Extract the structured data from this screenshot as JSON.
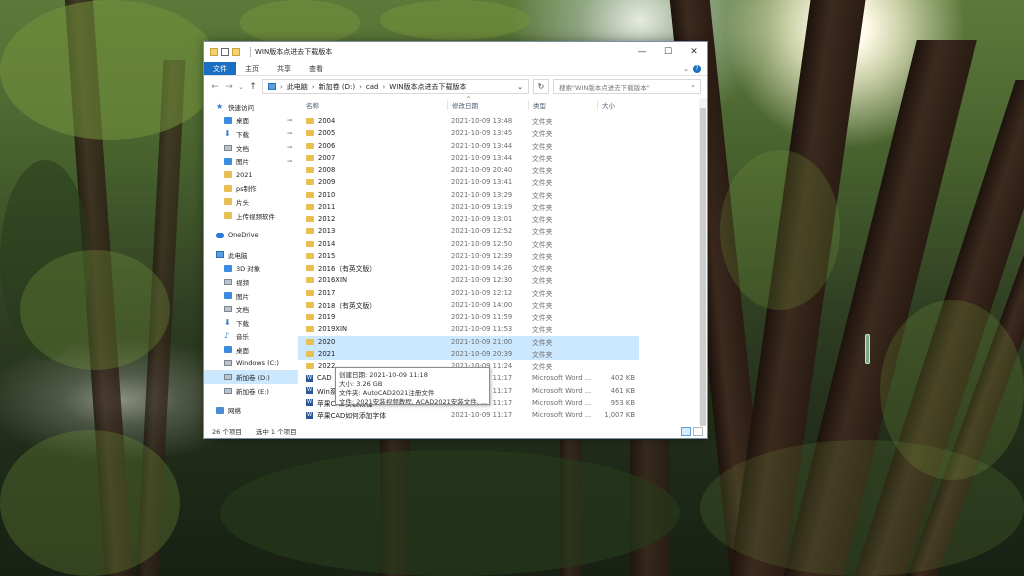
{
  "window": {
    "title": "WIN版本点进去下载版本",
    "controls": [
      "—",
      "☐",
      "✕"
    ]
  },
  "ribbon": {
    "tabs": [
      "文件",
      "主页",
      "共享",
      "查看"
    ],
    "expand": "⌄",
    "help": "?"
  },
  "address": {
    "back": "←",
    "forward": "→",
    "recent": "⌄",
    "up": "↑",
    "crumbs": [
      "此电脑",
      "新加卷 (D:)",
      "cad",
      "WIN版本点进去下载版本"
    ],
    "dropdown": "⌄",
    "refresh": "↻"
  },
  "search": {
    "placeholder": "搜索\"WIN版本点进去下载版本\"",
    "icon": "⌕"
  },
  "sidebar": {
    "items": [
      {
        "label": "快速访问",
        "icon": "star-icon"
      },
      {
        "label": "桌面",
        "icon": "desktop-icon",
        "pinned": true
      },
      {
        "label": "下载",
        "icon": "download-icon",
        "pinned": true
      },
      {
        "label": "文档",
        "icon": "documents-icon",
        "pinned": true
      },
      {
        "label": "图片",
        "icon": "pictures-icon",
        "pinned": true
      },
      {
        "label": "2021",
        "icon": "folder-icon"
      },
      {
        "label": "ps制作",
        "icon": "folder-icon"
      },
      {
        "label": "片头",
        "icon": "folder-icon"
      },
      {
        "label": "上传视频软件",
        "icon": "folder-icon"
      },
      {
        "label": "OneDrive",
        "icon": "cloud-icon"
      },
      {
        "label": "此电脑",
        "icon": "computer-icon"
      },
      {
        "label": "3D 对象",
        "icon": "3d-objects-icon"
      },
      {
        "label": "视频",
        "icon": "video-icon"
      },
      {
        "label": "图片",
        "icon": "pictures-icon"
      },
      {
        "label": "文档",
        "icon": "documents-icon"
      },
      {
        "label": "下载",
        "icon": "download-icon"
      },
      {
        "label": "音乐",
        "icon": "music-icon"
      },
      {
        "label": "桌面",
        "icon": "desktop-icon"
      },
      {
        "label": "Windows (C:)",
        "icon": "drive-icon"
      },
      {
        "label": "新加卷 (D:)",
        "icon": "drive-icon",
        "selected": true
      },
      {
        "label": "新加卷 (E:)",
        "icon": "drive-icon"
      },
      {
        "label": "网络",
        "icon": "network-icon"
      }
    ],
    "pin_glyph": "📌"
  },
  "columns": {
    "name": "名称",
    "date": "修改日期",
    "type": "类型",
    "size": "大小",
    "sort": "^"
  },
  "files": [
    {
      "name": "2004",
      "date": "2021-10-09 13:48",
      "type": "文件夹",
      "size": "",
      "kind": "folder"
    },
    {
      "name": "2005",
      "date": "2021-10-09 13:45",
      "type": "文件夹",
      "size": "",
      "kind": "folder"
    },
    {
      "name": "2006",
      "date": "2021-10-09 13:44",
      "type": "文件夹",
      "size": "",
      "kind": "folder"
    },
    {
      "name": "2007",
      "date": "2021-10-09 13:44",
      "type": "文件夹",
      "size": "",
      "kind": "folder"
    },
    {
      "name": "2008",
      "date": "2021-10-09 20:40",
      "type": "文件夹",
      "size": "",
      "kind": "folder"
    },
    {
      "name": "2009",
      "date": "2021-10-09 13:41",
      "type": "文件夹",
      "size": "",
      "kind": "folder"
    },
    {
      "name": "2010",
      "date": "2021-10-09 13:29",
      "type": "文件夹",
      "size": "",
      "kind": "folder"
    },
    {
      "name": "2011",
      "date": "2021-10-09 13:19",
      "type": "文件夹",
      "size": "",
      "kind": "folder"
    },
    {
      "name": "2012",
      "date": "2021-10-09 13:01",
      "type": "文件夹",
      "size": "",
      "kind": "folder"
    },
    {
      "name": "2013",
      "date": "2021-10-09 12:52",
      "type": "文件夹",
      "size": "",
      "kind": "folder"
    },
    {
      "name": "2014",
      "date": "2021-10-09 12:50",
      "type": "文件夹",
      "size": "",
      "kind": "folder"
    },
    {
      "name": "2015",
      "date": "2021-10-09 12:39",
      "type": "文件夹",
      "size": "",
      "kind": "folder"
    },
    {
      "name": "2016（有英文版）",
      "date": "2021-10-09 14:26",
      "type": "文件夹",
      "size": "",
      "kind": "folder"
    },
    {
      "name": "2016XIN",
      "date": "2021-10-09 12:30",
      "type": "文件夹",
      "size": "",
      "kind": "folder"
    },
    {
      "name": "2017",
      "date": "2021-10-09 12:12",
      "type": "文件夹",
      "size": "",
      "kind": "folder"
    },
    {
      "name": "2018（有英文版）",
      "date": "2021-10-09 14:00",
      "type": "文件夹",
      "size": "",
      "kind": "folder"
    },
    {
      "name": "2019",
      "date": "2021-10-09 11:59",
      "type": "文件夹",
      "size": "",
      "kind": "folder"
    },
    {
      "name": "2019XIN",
      "date": "2021-10-09 11:53",
      "type": "文件夹",
      "size": "",
      "kind": "folder"
    },
    {
      "name": "2020",
      "date": "2021-10-09 21:00",
      "type": "文件夹",
      "size": "",
      "kind": "folder",
      "selected": true
    },
    {
      "name": "2021",
      "date": "2021-10-09 20:39",
      "type": "文件夹",
      "size": "",
      "kind": "folder",
      "selected": true
    },
    {
      "name": "2022",
      "date": "2021-10-09 11:24",
      "type": "文件夹",
      "size": "",
      "kind": "folder"
    },
    {
      "name": "CAD",
      "date": "2021-10-09 11:17",
      "type": "Microsoft Word ...",
      "size": "402 KB",
      "kind": "word"
    },
    {
      "name": "Win系",
      "date": "2021-10-09 11:17",
      "type": "Microsoft Word ...",
      "size": "461 KB",
      "kind": "word"
    },
    {
      "name": "苹果CAD安装教程",
      "date": "2021-10-09 11:17",
      "type": "Microsoft Word ...",
      "size": "953 KB",
      "kind": "word"
    },
    {
      "name": "苹果CAD如何添加字体",
      "date": "2021-10-09 11:17",
      "type": "Microsoft Word ...",
      "size": "1,007 KB",
      "kind": "word"
    }
  ],
  "tooltip": {
    "line1": "创建日期: 2021-10-09 11:18",
    "line2": "大小: 3.26 GB",
    "line3": "文件夹: AutoCAD2021注册文件",
    "line4": "文件: 2021安装视频教程, ACAD2021安装文件, ..."
  },
  "status": {
    "count": "26 个项目",
    "selected": "选中 1 个项目"
  }
}
